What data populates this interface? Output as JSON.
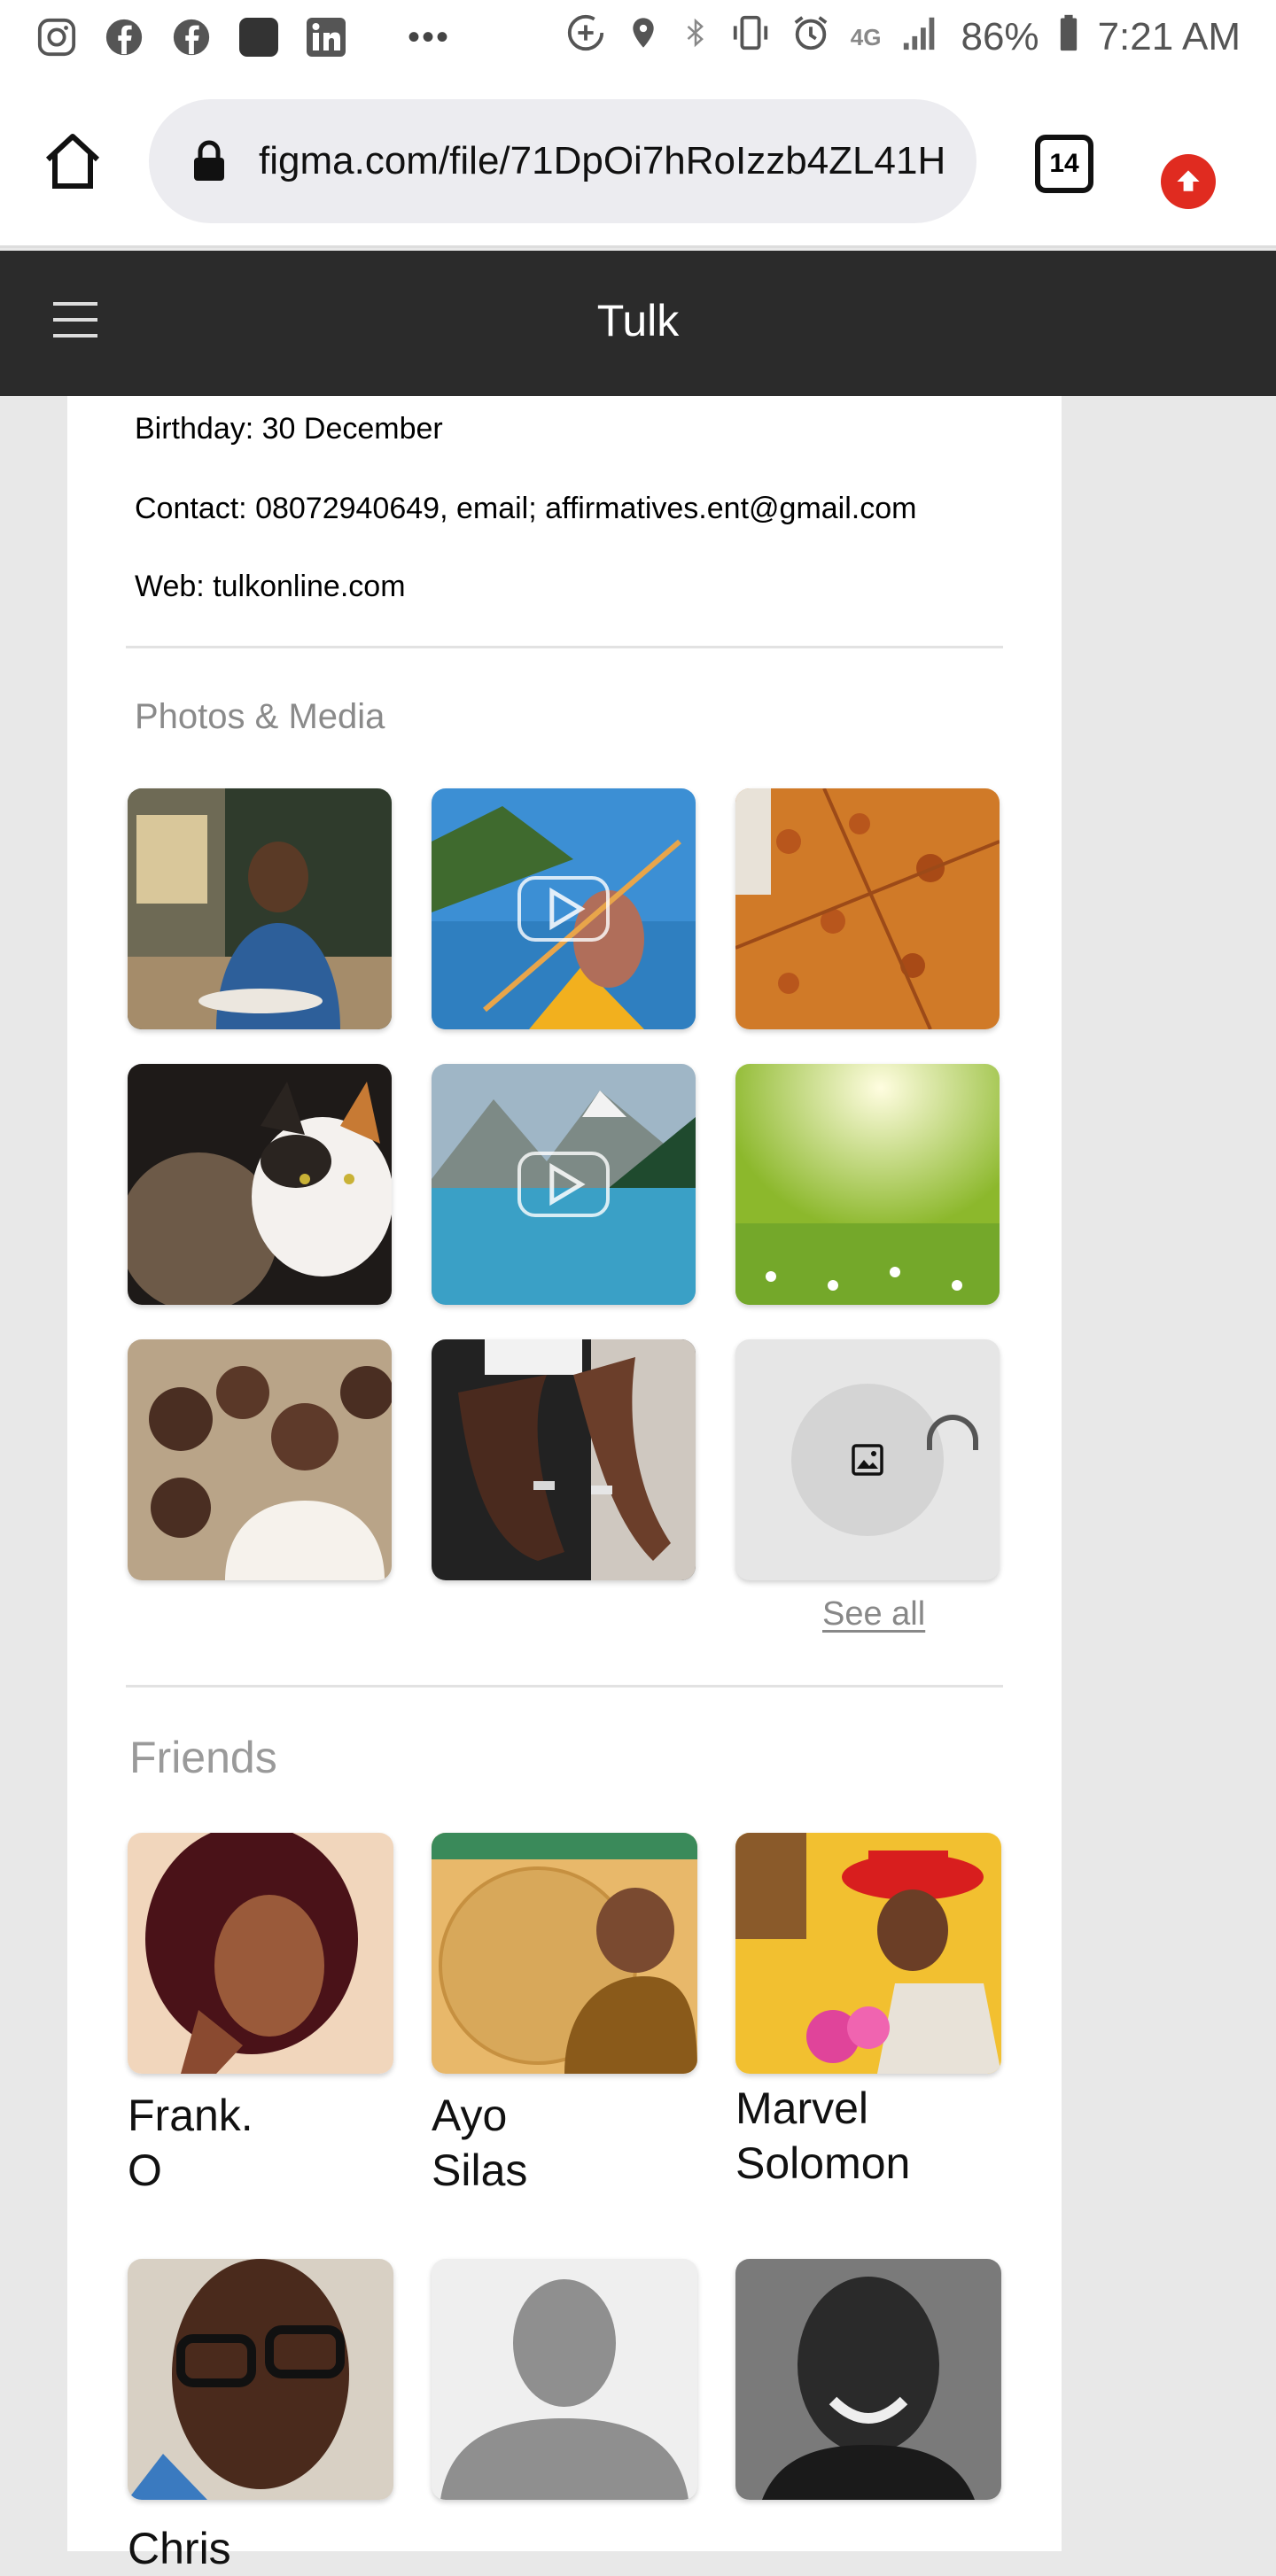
{
  "status_bar": {
    "icons": [
      "instagram-icon",
      "facebook-icon",
      "facebook-icon",
      "app-icon",
      "linkedin-icon"
    ],
    "more": "•••",
    "battery": "86%",
    "time": "7:21 AM",
    "network": "4G"
  },
  "browser": {
    "url": "figma.com/file/71DpOi7hRoIzzb4ZL41H",
    "tab_count": "14"
  },
  "app": {
    "title": "Tulk"
  },
  "profile": {
    "birthday": "Birthday: 30 December",
    "contact": "Contact: 08072940649,  email; affirmatives.ent@gmail.com",
    "web": "Web: tulkonline.com"
  },
  "media": {
    "title": "Photos & Media",
    "see_all": "See all",
    "items": [
      {
        "label": "man-dining-photo",
        "video": false
      },
      {
        "label": "kayak-lake-video",
        "video": true
      },
      {
        "label": "pizza-photo",
        "video": false
      },
      {
        "label": "kittens-photo",
        "video": false
      },
      {
        "label": "mountain-lake-video",
        "video": true
      },
      {
        "label": "sunny-meadow-photo",
        "video": false
      },
      {
        "label": "bridal-party-photo",
        "video": false
      },
      {
        "label": "wedding-rings-photo",
        "video": false
      },
      {
        "label": "image-placeholder",
        "video": false
      }
    ]
  },
  "friends": {
    "title": "Friends",
    "items": [
      {
        "name": "Frank.\nO"
      },
      {
        "name": "Ayo\nSilas"
      },
      {
        "name": "Marvel\nSolomon"
      },
      {
        "name": "Chris"
      },
      {
        "name": ""
      },
      {
        "name": ""
      }
    ]
  },
  "colors": {
    "appbar": "#2b2b2b",
    "accent_red": "#e02b20",
    "page_bg": "#e8e8e8"
  }
}
